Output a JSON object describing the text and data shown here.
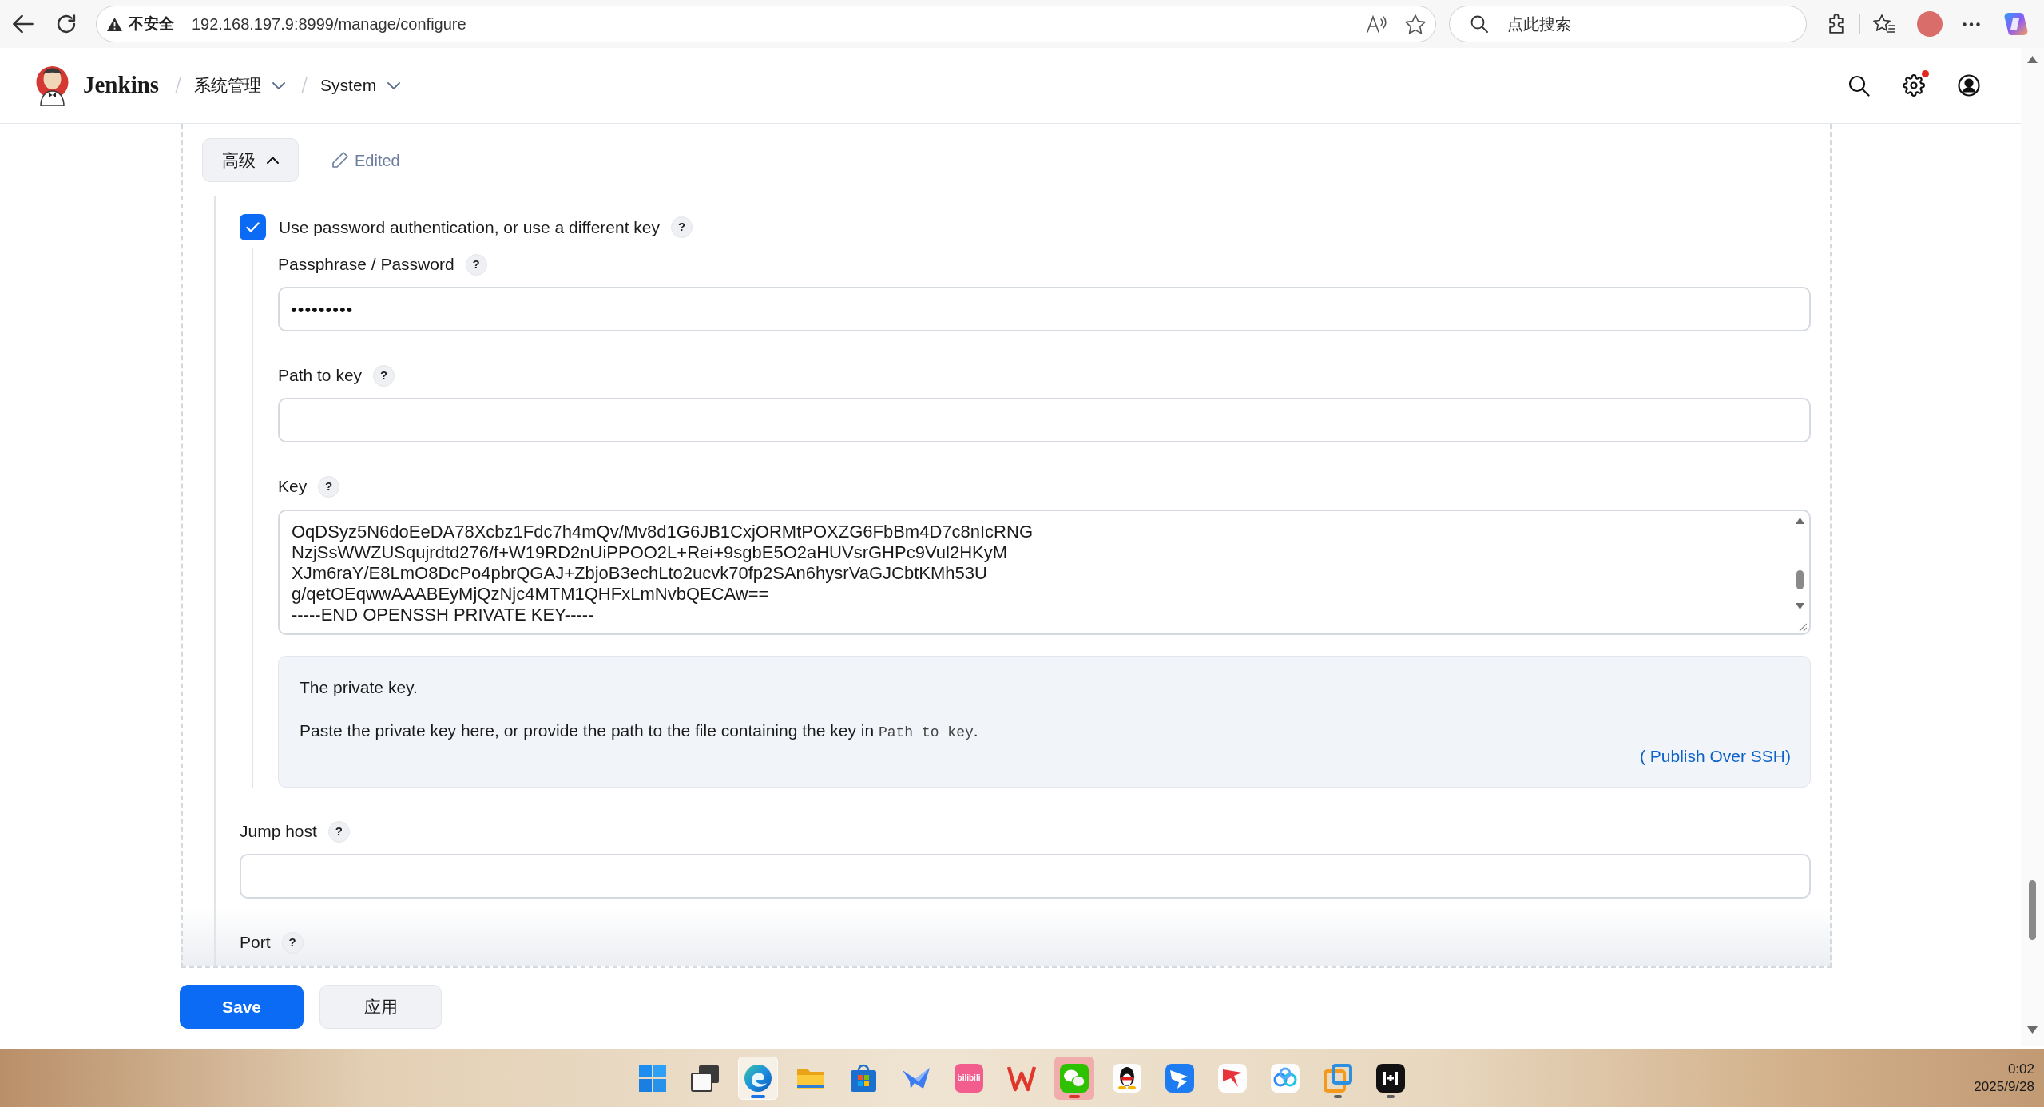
{
  "browser": {
    "security_label": "不安全",
    "url": "192.168.197.9:8999/manage/configure",
    "search": {
      "placeholder": "点此搜索"
    }
  },
  "header": {
    "brand": "Jenkins",
    "breadcrumbs": [
      {
        "label": "系统管理"
      },
      {
        "label": "System"
      }
    ],
    "settings_alert": true
  },
  "advanced": {
    "label": "高级",
    "expanded": true,
    "status": "Edited"
  },
  "auth_option": {
    "label": "Use password authentication, or use a different key",
    "help": "?",
    "checked": true,
    "fields": [
      {
        "kind": "input",
        "label": "Passphrase / Password",
        "help": "?",
        "value": "•••••••••"
      },
      {
        "kind": "input",
        "label": "Path to key",
        "help": "?"
      },
      {
        "kind": "textarea",
        "label": "Key",
        "help": "?",
        "lines": [
          "OqDSyz5N6doEeDA78Xcbz1Fdc7h4mQv/Mv8d1G6JB1CxjORMtPOXZG6FbBm4D7c8nIcRNG",
          "NzjSsWWZUSqujrdtd276/f+W19RD2nUiPPOO2L+Rei+9sgbE5O2aHUVsrGHPc9Vul2HKyM",
          "XJm6raY/E8LmO8DcPo4pbrQGAJ+ZbjoB3echLto2ucvk70fp2SAn6hysrVaGJCbtKMh53U",
          "g/qetOEqwwAAABEyMjQzNjc4MTM1QHFxLmNvbQECAw==",
          "-----END OPENSSH PRIVATE KEY-----"
        ],
        "help_text": {
          "title": "The private key.",
          "body": "Paste the private key here, or provide the path to the file containing the key in ",
          "code": "Path to key",
          "body_end": ".",
          "source": "( Publish Over SSH)"
        }
      }
    ]
  },
  "fields": [
    {
      "kind": "input",
      "label": "Jump host",
      "help": "?"
    },
    {
      "kind": "label",
      "label": "Port",
      "help": "?"
    }
  ],
  "buttons": [
    {
      "label": "Save",
      "kind": "primary"
    },
    {
      "label": "应用",
      "kind": "secondary"
    }
  ],
  "taskbar": {
    "apps": [
      {
        "kind": "start",
        "selected": false,
        "attention": false,
        "running": false
      },
      {
        "kind": "task_view",
        "selected": false,
        "attention": false,
        "running": false
      },
      {
        "kind": "browser",
        "selected": true,
        "attention": false,
        "running": true
      },
      {
        "kind": "files",
        "selected": false,
        "attention": false,
        "running": false
      },
      {
        "kind": "store",
        "selected": false,
        "attention": false,
        "running": false
      },
      {
        "kind": "bird",
        "selected": false,
        "attention": false,
        "running": false
      },
      {
        "kind": "video",
        "label": "bilibili",
        "selected": false,
        "attention": false,
        "running": false
      },
      {
        "kind": "office",
        "selected": false,
        "attention": false,
        "running": false
      },
      {
        "kind": "chat",
        "selected": false,
        "attention": true,
        "running": true
      },
      {
        "kind": "penguin",
        "selected": false,
        "attention": false,
        "running": false
      },
      {
        "kind": "wing",
        "selected": false,
        "attention": false,
        "running": false
      },
      {
        "kind": "arrow",
        "selected": false,
        "attention": false,
        "running": false
      },
      {
        "kind": "cloud",
        "selected": false,
        "attention": false,
        "running": false
      },
      {
        "kind": "squares",
        "selected": false,
        "attention": false,
        "running": true
      },
      {
        "kind": "bars",
        "selected": false,
        "attention": false,
        "running": true
      }
    ],
    "time": "0:02",
    "date": "2025/9/28"
  }
}
